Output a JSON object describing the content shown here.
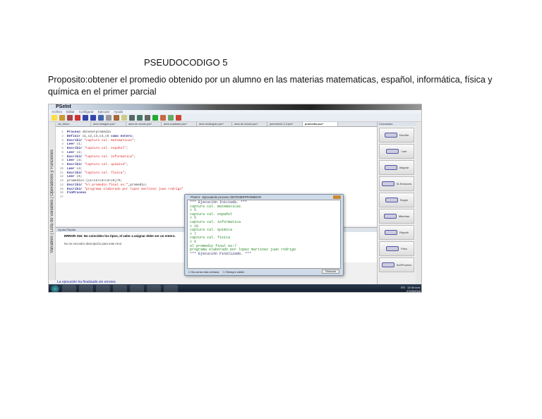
{
  "doc": {
    "title": "PSEUDOCODIGO 5",
    "purpose": "Proposito:obtener el promedio obtenido por un alumno en las materias matematicas, español, informática, física y química en el primer parcial"
  },
  "app": {
    "window_title": "PSeInt",
    "menu": [
      "Archivo",
      "Editar",
      "Configurar",
      "Ejecutar",
      "Ayuda"
    ],
    "tabs": [
      "sin_titulo>",
      "area triangulo.psc*",
      "area de circulo.psc*",
      "area cuadrado.psc*",
      "area rectangulo.psc*",
      "area de circulo.psc*",
      "pereceles1,2,3.psc*",
      "promedio.psc*"
    ],
    "side_left": "Variables | Lista de variables | Operadores y Funciones",
    "code": [
      {
        "n": "1",
        "parts": [
          [
            "kw",
            "Proceso "
          ],
          [
            "tx",
            "obtenerpromedio"
          ]
        ]
      },
      {
        "n": "2",
        "parts": [
          [
            "kw",
            "Definir "
          ],
          [
            "tx",
            "c1,c2,c3,c4,c5 "
          ],
          [
            "kw",
            "como entero"
          ],
          [
            "tx",
            ";"
          ]
        ]
      },
      {
        "n": "3",
        "parts": [
          [
            "kw",
            "Escribir "
          ],
          [
            "st",
            "\"captura cal. matematicas\""
          ],
          [
            "tx",
            ";"
          ]
        ]
      },
      {
        "n": "4",
        "parts": [
          [
            "kw",
            "Leer "
          ],
          [
            "tx",
            "c1;"
          ]
        ]
      },
      {
        "n": "5",
        "parts": [
          [
            "kw",
            "Escribir "
          ],
          [
            "st",
            "\"captura cal. español\""
          ],
          [
            "tx",
            ";"
          ]
        ]
      },
      {
        "n": "6",
        "parts": [
          [
            "kw",
            "Leer "
          ],
          [
            "tx",
            "c2;"
          ]
        ]
      },
      {
        "n": "7",
        "parts": [
          [
            "kw",
            "Escribir "
          ],
          [
            "st",
            "\"captura cal. informatica\""
          ],
          [
            "tx",
            ";"
          ]
        ]
      },
      {
        "n": "8",
        "parts": [
          [
            "kw",
            "Leer "
          ],
          [
            "tx",
            "c3;"
          ]
        ]
      },
      {
        "n": "9",
        "parts": [
          [
            "kw",
            "Escribir "
          ],
          [
            "st",
            "\"captura cal. quimica\""
          ],
          [
            "tx",
            ";"
          ]
        ]
      },
      {
        "n": "10",
        "parts": [
          [
            "kw",
            "Leer "
          ],
          [
            "tx",
            "c4;"
          ]
        ]
      },
      {
        "n": "11",
        "parts": [
          [
            "kw",
            "Escribir "
          ],
          [
            "st",
            "\"captura cal. fisica\""
          ],
          [
            "tx",
            ";"
          ]
        ]
      },
      {
        "n": "12",
        "parts": [
          [
            "kw",
            "Leer "
          ],
          [
            "tx",
            "c5;"
          ]
        ]
      },
      {
        "n": "13",
        "parts": [
          [
            "tx",
            "promedio<-(c1+c2+c3+c4+c5)/5;"
          ]
        ]
      },
      {
        "n": "14",
        "parts": [
          [
            "kw",
            "Escribir "
          ],
          [
            "st",
            "\"el promedio final es:\""
          ],
          [
            "tx",
            ",promedio;"
          ]
        ]
      },
      {
        "n": "15",
        "parts": [
          [
            "kw",
            "Escribir "
          ],
          [
            "st",
            "\"programa elaborado por lopez martinez juan rodrigo\""
          ]
        ]
      },
      {
        "n": "16",
        "parts": [
          [
            "kw",
            "FinProceso"
          ]
        ]
      },
      {
        "n": "17",
        "parts": []
      }
    ],
    "help": {
      "title": "Ayuda Rápida",
      "error": "ERROR 316: No coinciden los tipos, el valor a asignar debe ser un entero.",
      "desc": "No se encontro descripción para este error"
    },
    "commands": {
      "title": "Comandos",
      "items": [
        "Escribir",
        "Leer",
        "Asignar",
        "Si-Entonces",
        "Según",
        "Mientras",
        "Repetir",
        "Para",
        "SubProceso"
      ]
    },
    "status": "La ejecución ha finalizado sin errores.",
    "clock": {
      "lang": "ES",
      "time": "12:44 a.m.",
      "date": "07/09/2016"
    }
  },
  "popup": {
    "title": "PSeInt - Ejecutando proceso OBTENERPROMEDIO",
    "lines": [
      [
        "pb",
        "*** Ejecución Iniciada. ***"
      ],
      [
        "g",
        "captura cal. matematicas"
      ],
      [
        "g",
        "> 5"
      ],
      [
        "g",
        "captura cal. español"
      ],
      [
        "g",
        "> 5"
      ],
      [
        "g",
        "captura cal. informatica"
      ],
      [
        "g",
        "> 10"
      ],
      [
        "g",
        "captura cal. quimica"
      ],
      [
        "g",
        "> 7"
      ],
      [
        "g",
        "captura cal. fisica"
      ],
      [
        "g",
        "> 6"
      ],
      [
        "g",
        "el promedio final es:7"
      ],
      [
        "g",
        "programa elaborado por lopez martinez juan rodrigo"
      ],
      [
        "pb",
        "*** Ejecución Finalizada. ***"
      ]
    ],
    "opt1": "No cerrar esta ventana",
    "opt2": "Siempre visible",
    "button": "Reiniciar"
  }
}
